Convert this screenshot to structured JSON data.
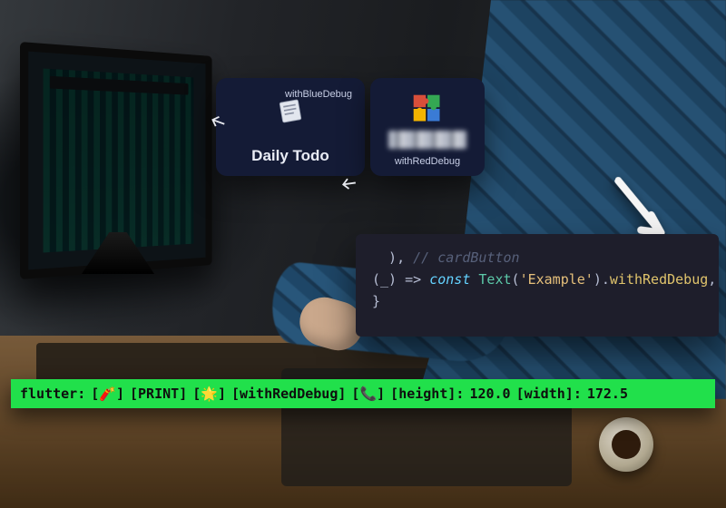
{
  "cards": {
    "left": {
      "top_label": "withBlueDebug",
      "title": "Daily Todo"
    },
    "right": {
      "bottom_label": "withRedDebug"
    }
  },
  "code": {
    "line1_comment_tail": "// cardButton",
    "line2": {
      "open": "(_) => ",
      "keyword": "const",
      "space": " ",
      "type": "Text",
      "str_open": "(",
      "str": "'Example'",
      "str_close": ")",
      "dot": ".",
      "call": "withRedDebug",
      "trail": ","
    },
    "line3": "}"
  },
  "console": {
    "prefix": "flutter:",
    "open": "[",
    "close": "]",
    "print": "PRINT",
    "tag": "withRedDebug",
    "height_label": "height",
    "height_value": "120.0",
    "width_label": "width",
    "width_value": "172.5",
    "emoji_firecracker": "🧨",
    "emoji_sparkle": "🌟",
    "emoji_phone": "📞"
  },
  "icons": {
    "page": "page-icon",
    "puzzle": "puzzle-icon",
    "arrow": "arrow-icon"
  }
}
